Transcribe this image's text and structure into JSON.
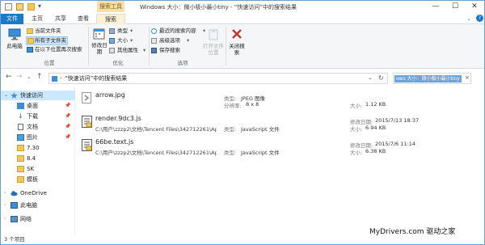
{
  "window": {
    "title": "Windows 大小：微小极小最小tiny - “快速访问”中的搜索结果",
    "context_tab_header": "搜索工具",
    "controls": {
      "minimize": "—",
      "maximize": "☐",
      "close": "✕"
    }
  },
  "tabs": [
    "文件",
    "主页",
    "共享",
    "查看",
    "搜索"
  ],
  "ribbon": {
    "location": {
      "this_pc": "此电脑",
      "current_folder": "当前文件夹",
      "all_subfolders": "所有子文件夹",
      "search_again": "在以下位置再次搜索",
      "label": "位置"
    },
    "refine": {
      "modified_date": "修改日期",
      "type": "类型",
      "size": "大小",
      "other_props": "其他属性",
      "label": "优化"
    },
    "options": {
      "recent_searches": "最近的搜索内容",
      "advanced": "高级选项",
      "save_search": "保存搜索",
      "open_location": "打开文件位置",
      "label": "选项"
    },
    "close_search": "关闭搜索"
  },
  "address": {
    "path": "“快速访问”中的搜索结果",
    "search_query": "ows 大小：微小极小最小tiny"
  },
  "nav": {
    "items": [
      {
        "label": "快速访问",
        "pinned": false,
        "selected": true
      },
      {
        "label": "桌面",
        "pinned": true
      },
      {
        "label": "下载",
        "pinned": true
      },
      {
        "label": "文档",
        "pinned": true
      },
      {
        "label": "图片",
        "pinned": true
      },
      {
        "label": "7.30",
        "pinned": false
      },
      {
        "label": "8.4",
        "pinned": false
      },
      {
        "label": "SK",
        "pinned": false
      },
      {
        "label": "模板",
        "pinned": false
      },
      {
        "label": "OneDrive",
        "pinned": false
      },
      {
        "label": "此电脑",
        "pinned": false
      },
      {
        "label": "网络",
        "pinned": false
      }
    ]
  },
  "files": [
    {
      "name": "arrow.jpg",
      "path": "",
      "type_label": "类型:",
      "type_value": "JPEG 图像",
      "extra_label": "分辨率:",
      "extra_value": "8 x 8",
      "date_label": "",
      "date_value": "",
      "size_label": "大小:",
      "size_value": "1.12 KB"
    },
    {
      "name": "render.9dc3.js",
      "path": "C:\\用户\\zzzp2\\文档\\Tencent Files\\342712261\\Ap...",
      "type_label": "类型:",
      "type_value": "JavaScript 文件",
      "extra_label": "",
      "extra_value": "",
      "date_label": "修改日期:",
      "date_value": "2015/7/13 18:37",
      "size_label": "大小:",
      "size_value": "6.94 KB"
    },
    {
      "name": "66be.text.js",
      "path": "C:\\用户\\zzzp2\\文档\\Tencent Files\\342712261\\Ap...",
      "type_label": "类型:",
      "type_value": "JavaScript 文件",
      "extra_label": "",
      "extra_value": "",
      "date_label": "修改日期:",
      "date_value": "2015/7/6 11:14",
      "size_label": "大小:",
      "size_value": "6.38 KB"
    }
  ],
  "status": {
    "item_count": "3 个项目"
  },
  "watermark": "MyDrivers.com 驱动之家",
  "colors": {
    "accent": "#1979ca",
    "context": "#f5dfa7",
    "selection": "#cce8ff",
    "search_highlight": "#6aa3da",
    "close_red": "#c0392b"
  }
}
